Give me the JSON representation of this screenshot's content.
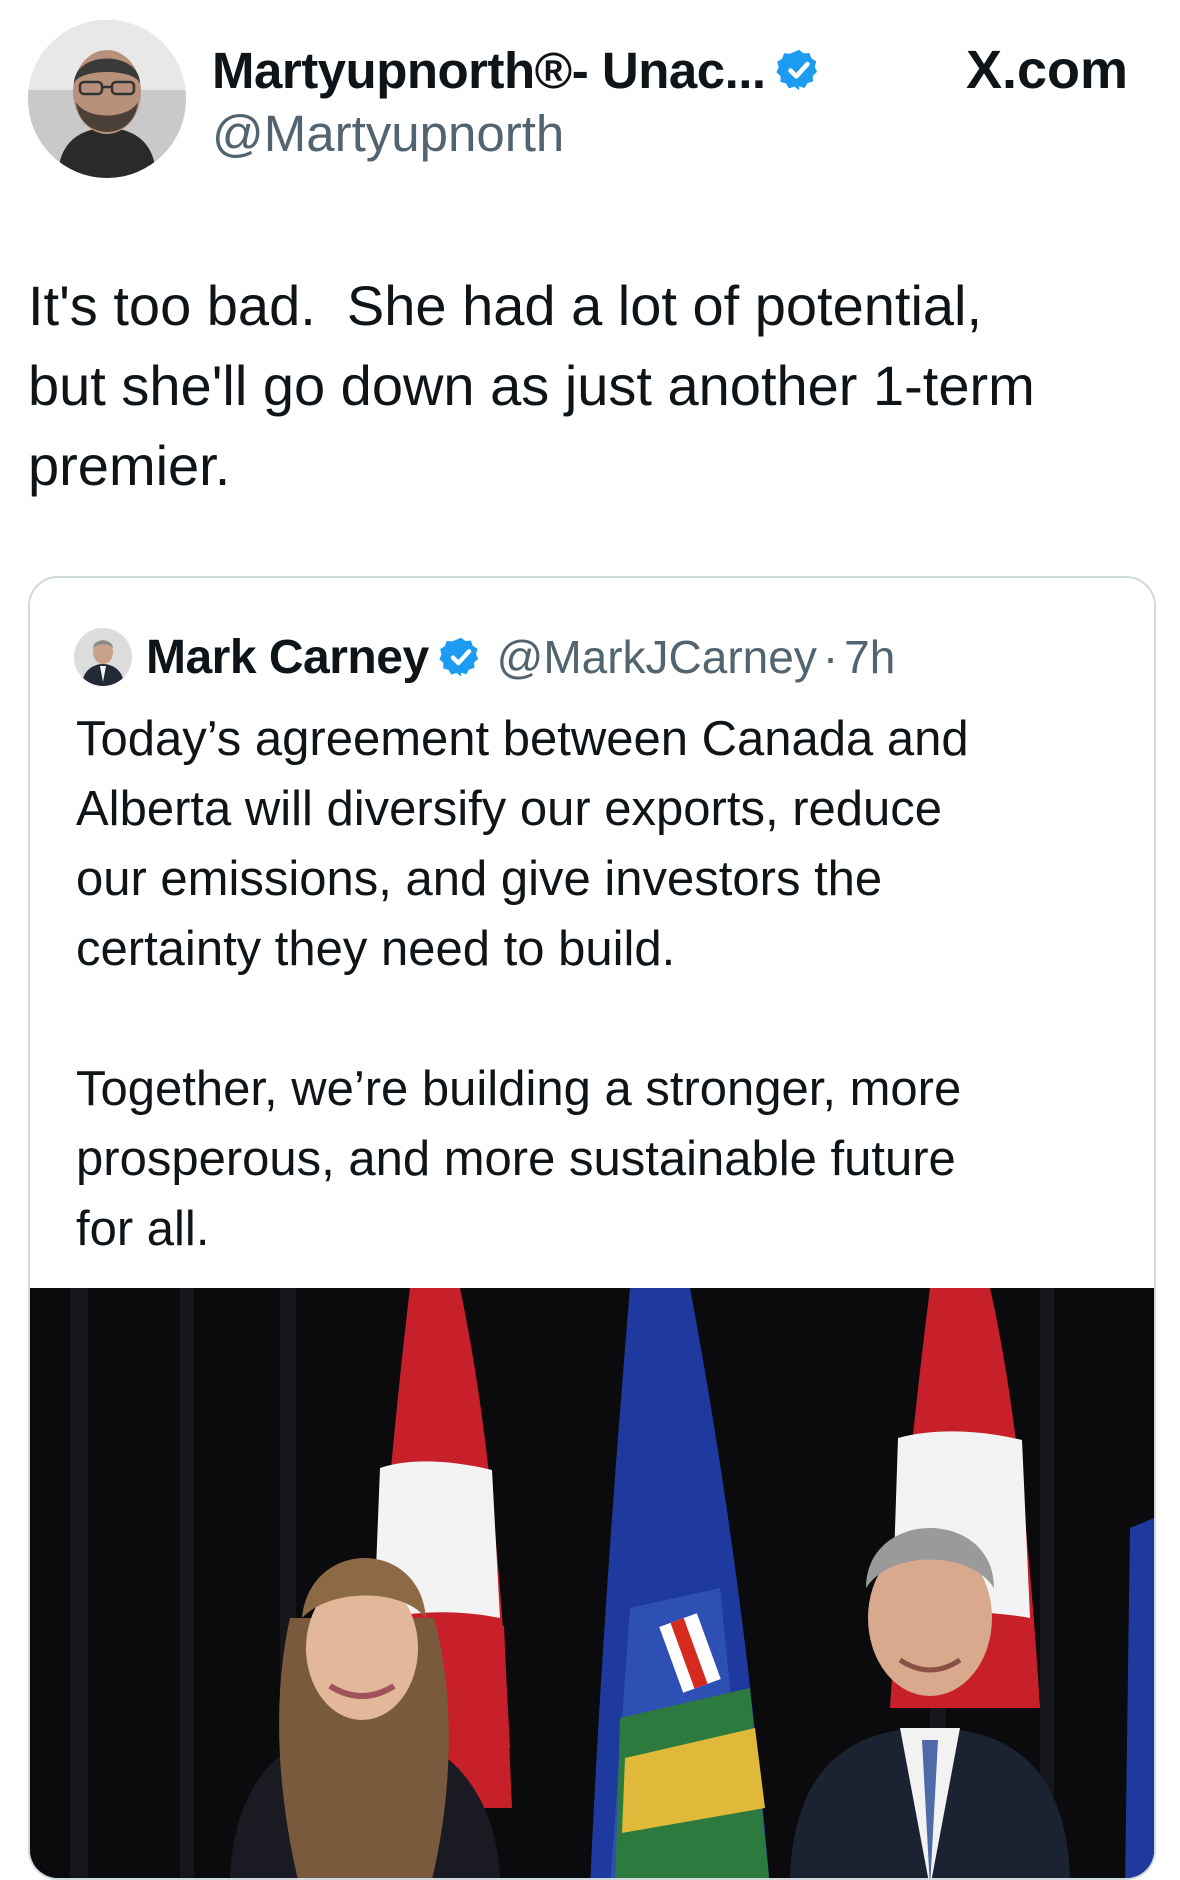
{
  "header": {
    "display_name": "Martyupnorth®- Unac...",
    "handle": "@Martyupnorth",
    "site_label": "X.com",
    "verified_icon": "verified-badge-icon",
    "verified_color": "#1d9bf0"
  },
  "tweet": {
    "text": "It's too bad.  She had a lot of potential,\nbut she'll go down as just another 1-term\npremier."
  },
  "quoted_tweet": {
    "display_name": "Mark Carney",
    "handle": "@MarkJCarney",
    "separator": "·",
    "time": "7h",
    "text": "Today’s agreement between Canada and\nAlberta will diversify our exports, reduce\nour emissions, and give investors the\ncertainty they need to build.\n\nTogether, we’re building a stronger, more\nprosperous, and more sustainable future\nfor all.",
    "media": "photo-canada-alberta-flags-two-people"
  },
  "colors": {
    "text_primary": "#0f1419",
    "text_secondary": "#536471",
    "border": "#cfd9de",
    "verified": "#1d9bf0",
    "flag_red": "#d52b1e",
    "alberta_blue": "#1f3a9e"
  }
}
